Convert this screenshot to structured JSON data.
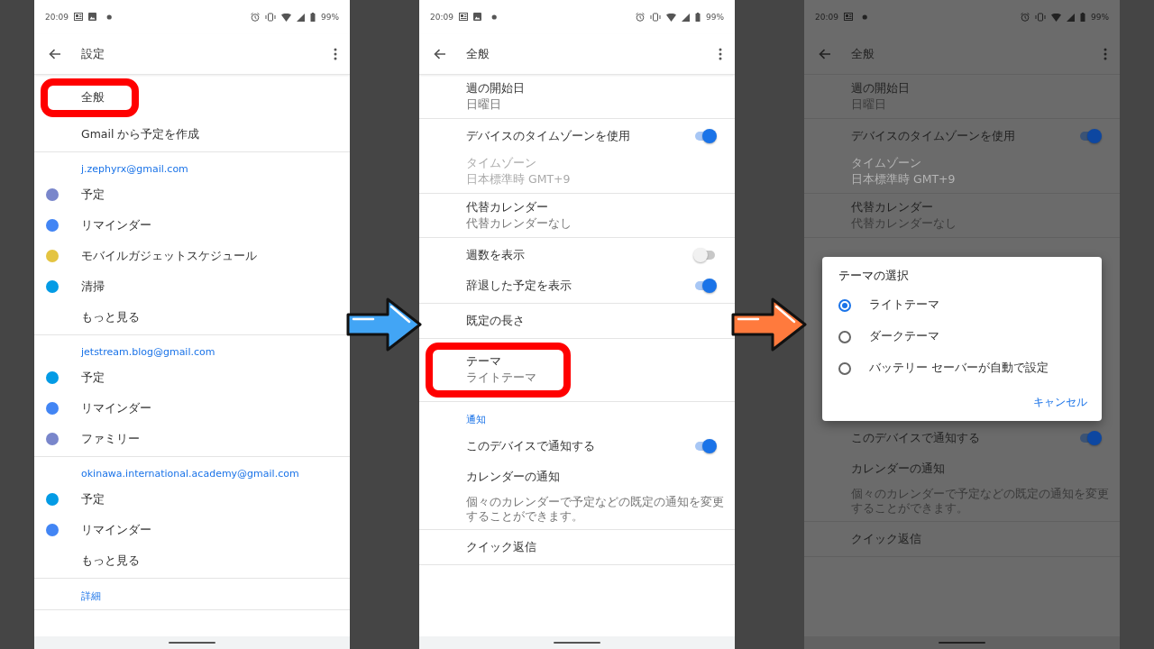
{
  "panels": [
    {
      "dimmed": false,
      "status_bar": {
        "time": "20:09",
        "notification_icons": [
          {
            "kind": "news"
          },
          {
            "kind": "image"
          },
          {
            "kind": "moon"
          }
        ],
        "battery": "99%"
      },
      "app_bar": {
        "title": "設定"
      },
      "sections": [
        {
          "kind": "group",
          "rows": [
            {
              "kind": "item",
              "label": "全般",
              "highlighted": true
            },
            {
              "kind": "item",
              "label": "Gmail から予定を作成",
              "highlighted": false
            }
          ]
        },
        {
          "kind": "group",
          "header": "j.zephyrx@gmail.com",
          "rows": [
            {
              "kind": "calendar",
              "label": "予定",
              "color": "#7986cb"
            },
            {
              "kind": "calendar",
              "label": "リマインダー",
              "color": "#4285f4"
            },
            {
              "kind": "calendar",
              "label": "モバイルガジェットスケジュール",
              "color": "#e4c441"
            },
            {
              "kind": "calendar",
              "label": "清掃",
              "color": "#039be5"
            },
            {
              "kind": "item",
              "label": "もっと見る",
              "highlighted": false
            }
          ]
        },
        {
          "kind": "group",
          "header": "jetstream.blog@gmail.com",
          "rows": [
            {
              "kind": "calendar",
              "label": "予定",
              "color": "#039be5"
            },
            {
              "kind": "calendar",
              "label": "リマインダー",
              "color": "#4285f4"
            },
            {
              "kind": "calendar",
              "label": "ファミリー",
              "color": "#7986cb"
            }
          ]
        },
        {
          "kind": "group",
          "header": "okinawa.international.academy@gmail.com",
          "rows": [
            {
              "kind": "calendar",
              "label": "予定",
              "color": "#039be5"
            },
            {
              "kind": "calendar",
              "label": "リマインダー",
              "color": "#4285f4"
            },
            {
              "kind": "item",
              "label": "もっと見る",
              "highlighted": false
            }
          ]
        },
        {
          "kind": "group",
          "header": "詳細"
        }
      ]
    },
    {
      "dimmed": false,
      "status_bar": {
        "time": "20:09",
        "notification_icons": [
          {
            "kind": "news"
          },
          {
            "kind": "image"
          },
          {
            "kind": "moon"
          }
        ],
        "battery": "99%"
      },
      "app_bar": {
        "title": "全般"
      },
      "sections": [
        {
          "kind": "group",
          "rows": [
            {
              "kind": "item",
              "label": "週の開始日",
              "sublabel": "日曜日",
              "highlighted": false,
              "disabled": false
            }
          ]
        },
        {
          "kind": "group",
          "rows": [
            {
              "kind": "toggle",
              "label": "デバイスのタイムゾーンを使用",
              "on": true
            },
            {
              "kind": "item",
              "label": "タイムゾーン",
              "sublabel": "日本標準時 GMT+9",
              "highlighted": false,
              "disabled": true
            }
          ]
        },
        {
          "kind": "group",
          "rows": [
            {
              "kind": "item",
              "label": "代替カレンダー",
              "sublabel": "代替カレンダーなし",
              "highlighted": false,
              "disabled": false
            }
          ]
        },
        {
          "kind": "group",
          "rows": [
            {
              "kind": "toggle",
              "label": "週数を表示",
              "on": false
            },
            {
              "kind": "toggle",
              "label": "辞退した予定を表示",
              "on": true
            }
          ]
        },
        {
          "kind": "group",
          "rows": [
            {
              "kind": "item",
              "label": "既定の長さ",
              "highlighted": false,
              "disabled": false
            }
          ]
        },
        {
          "kind": "group",
          "rows": [
            {
              "kind": "item",
              "label": "テーマ",
              "sublabel": "ライトテーマ",
              "highlighted": true,
              "disabled": false
            }
          ]
        },
        {
          "kind": "group",
          "header": "通知",
          "rows": [
            {
              "kind": "toggle",
              "label": "このデバイスで通知する",
              "on": true
            },
            {
              "kind": "item",
              "label": "カレンダーの通知",
              "highlighted": false,
              "disabled": false
            },
            {
              "kind": "note",
              "label": "個々のカレンダーで予定などの既定の通知を変更することができます。"
            }
          ]
        },
        {
          "kind": "group",
          "rows": [
            {
              "kind": "item",
              "label": "クイック返信",
              "highlighted": false,
              "disabled": false
            }
          ]
        }
      ]
    },
    {
      "dimmed": true,
      "status_bar": {
        "time": "20:09",
        "notification_icons": [
          {
            "kind": "news"
          },
          {
            "kind": "moon"
          }
        ],
        "battery": "99%"
      },
      "app_bar": {
        "title": "全般"
      },
      "sections": [
        {
          "kind": "group",
          "rows": [
            {
              "kind": "item",
              "label": "週の開始日",
              "sublabel": "日曜日",
              "highlighted": false,
              "disabled": false
            }
          ]
        },
        {
          "kind": "group",
          "rows": [
            {
              "kind": "toggle",
              "label": "デバイスのタイムゾーンを使用",
              "on": true
            },
            {
              "kind": "item",
              "label": "タイムゾーン",
              "sublabel": "日本標準時 GMT+9",
              "highlighted": false,
              "disabled": true
            }
          ]
        },
        {
          "kind": "group",
          "rows": [
            {
              "kind": "item",
              "label": "代替カレンダー",
              "sublabel": "代替カレンダーなし",
              "highlighted": false,
              "disabled": false
            }
          ]
        },
        {
          "kind": "dialog",
          "title": "テーマの選択",
          "options": [
            {
              "label": "ライトテーマ",
              "selected": true
            },
            {
              "label": "ダークテーマ",
              "selected": false
            },
            {
              "label": "バッテリー セーバーが自動で設定",
              "selected": false
            }
          ],
          "cancel": "キャンセル"
        },
        {
          "kind": "group",
          "rows": [
            {
              "kind": "toggle",
              "label": "このデバイスで通知する",
              "on": true
            },
            {
              "kind": "item",
              "label": "カレンダーの通知",
              "highlighted": false,
              "disabled": false
            },
            {
              "kind": "note",
              "label": "個々のカレンダーで予定などの既定の通知を変更することができます。"
            }
          ]
        },
        {
          "kind": "group",
          "rows": [
            {
              "kind": "item",
              "label": "クイック返信",
              "highlighted": false,
              "disabled": false
            }
          ]
        }
      ]
    }
  ],
  "arrows": [
    {
      "color": "#42a5f5"
    },
    {
      "color": "#ff7a3d"
    }
  ]
}
